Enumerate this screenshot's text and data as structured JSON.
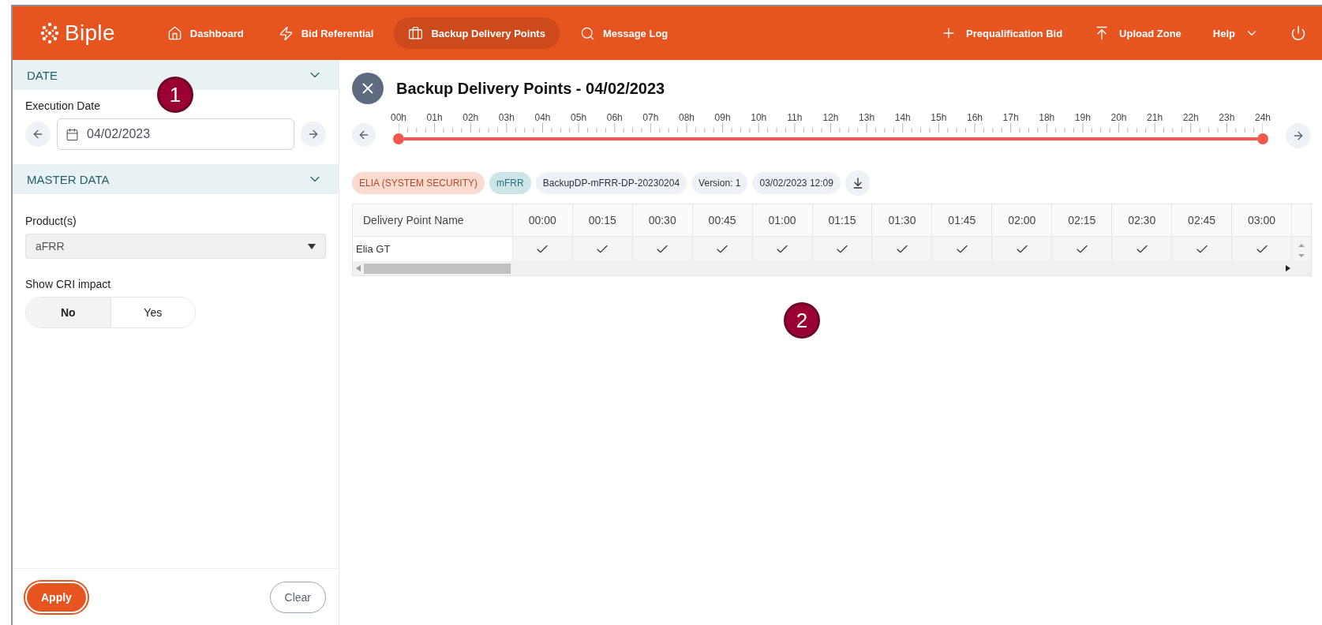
{
  "brand": "Biple",
  "nav": [
    {
      "label": "Dashboard",
      "selected": false
    },
    {
      "label": "Bid Referential",
      "selected": false
    },
    {
      "label": "Backup Delivery Points",
      "selected": true
    },
    {
      "label": "Message Log",
      "selected": false
    }
  ],
  "nav_right": {
    "prequalification": "Prequalification Bid",
    "upload": "Upload Zone",
    "help": "Help"
  },
  "sidebar": {
    "date_section": {
      "title": "DATE",
      "label": "Execution Date",
      "value": "04/02/2023"
    },
    "master_section": {
      "title": "MASTER DATA",
      "product_label": "Product(s)",
      "product_value": "aFRR",
      "cri_label": "Show CRI impact",
      "cri_options": [
        {
          "label": "No",
          "selected": true
        },
        {
          "label": "Yes",
          "selected": false
        }
      ]
    },
    "apply": "Apply",
    "clear": "Clear"
  },
  "main": {
    "title": "Backup Delivery Points - 04/02/2023",
    "timeline": {
      "labels": [
        "00h",
        "01h",
        "02h",
        "03h",
        "04h",
        "05h",
        "06h",
        "07h",
        "08h",
        "09h",
        "10h",
        "11h",
        "12h",
        "13h",
        "14h",
        "15h",
        "16h",
        "17h",
        "18h",
        "19h",
        "20h",
        "21h",
        "22h",
        "23h",
        "24h"
      ],
      "thumbs": [
        {
          "level": 0
        },
        {
          "level": 1
        }
      ]
    },
    "chips": [
      {
        "kind": "company",
        "label": "ELIA (SYSTEM SECURITY)"
      },
      {
        "kind": "product",
        "label": "mFRR"
      },
      {
        "kind": "plain",
        "label": "BackupDP-mFRR-DP-20230204"
      },
      {
        "kind": "plain",
        "label": "Version: 1"
      },
      {
        "kind": "plain",
        "label": "03/02/2023 12:09"
      }
    ],
    "table": {
      "columns": [
        "Delivery Point Name",
        "00:00",
        "00:15",
        "00:30",
        "00:45",
        "01:00",
        "01:15",
        "01:30",
        "01:45",
        "02:00",
        "02:15",
        "02:30",
        "02:45",
        "03:00"
      ],
      "rows": [
        {
          "name": "Elia GT",
          "cells": [
            {
              "checked": true
            },
            {
              "checked": true
            },
            {
              "checked": true
            },
            {
              "checked": true
            },
            {
              "checked": true
            },
            {
              "checked": true
            },
            {
              "checked": true
            },
            {
              "checked": true
            },
            {
              "checked": true
            },
            {
              "checked": true
            },
            {
              "checked": true
            },
            {
              "checked": true
            },
            {
              "checked": true
            }
          ]
        }
      ]
    }
  },
  "callouts": [
    "1",
    "2"
  ]
}
